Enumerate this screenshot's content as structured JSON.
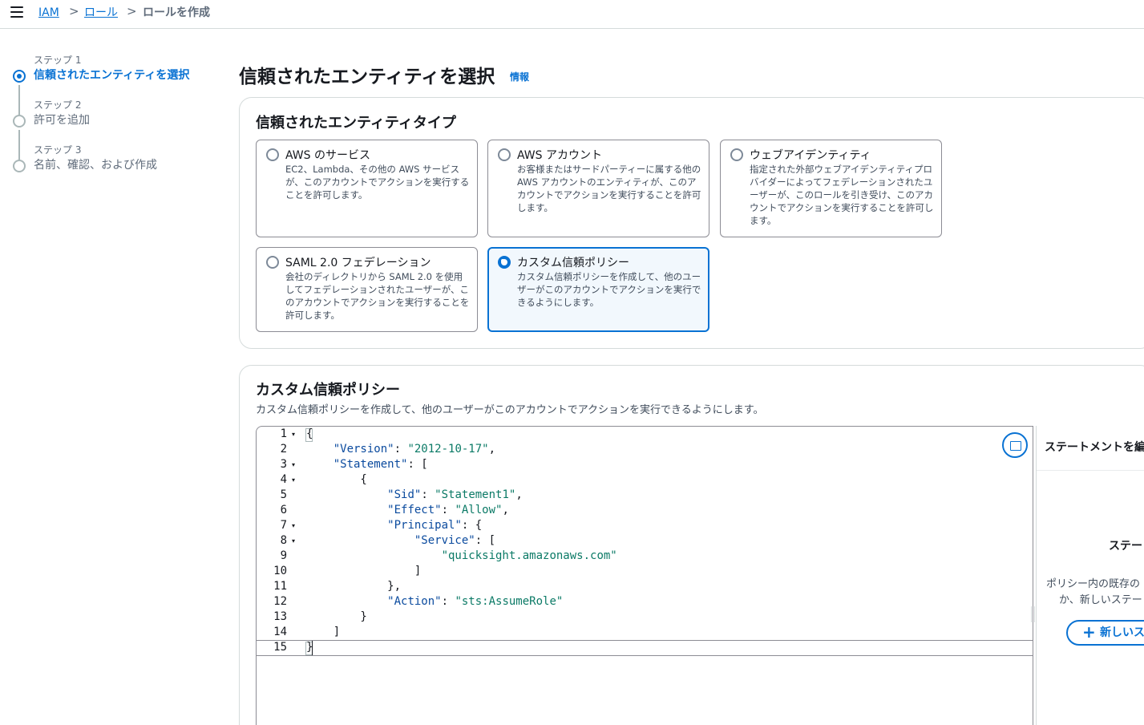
{
  "breadcrumb": {
    "items": [
      "IAM",
      "ロール"
    ],
    "separators": [
      ">",
      ">"
    ],
    "current": "ロールを作成"
  },
  "steps": [
    {
      "label": "ステップ 1",
      "title": "信頼されたエンティティを選択",
      "active": true
    },
    {
      "label": "ステップ 2",
      "title": "許可を追加",
      "active": false
    },
    {
      "label": "ステップ 3",
      "title": "名前、確認、および作成",
      "active": false
    }
  ],
  "page": {
    "title": "信頼されたエンティティを選択",
    "info_link": "情報"
  },
  "entity_type": {
    "title": "信頼されたエンティティタイプ",
    "options": [
      {
        "title": "AWS のサービス",
        "desc": "EC2、Lambda、その他の AWS サービスが、このアカウントでアクションを実行することを許可します。",
        "selected": false
      },
      {
        "title": "AWS アカウント",
        "desc": "お客様またはサードパーティーに属する他の AWS アカウントのエンティティが、このアカウントでアクションを実行することを許可します。",
        "selected": false
      },
      {
        "title": "ウェブアイデンティティ",
        "desc": "指定された外部ウェブアイデンティティプロバイダーによってフェデレーションされたユーザーが、このロールを引き受け、このアカウントでアクションを実行することを許可します。",
        "selected": false
      },
      {
        "title": "SAML 2.0 フェデレーション",
        "desc": "会社のディレクトリから SAML 2.0 を使用してフェデレーションされたユーザーが、このアカウントでアクションを実行することを許可します。",
        "selected": false
      },
      {
        "title": "カスタム信頼ポリシー",
        "desc": "カスタム信頼ポリシーを作成して、他のユーザーがこのアカウントでアクションを実行できるようにします。",
        "selected": true
      }
    ]
  },
  "custom_policy": {
    "title": "カスタム信頼ポリシー",
    "desc": "カスタム信頼ポリシーを作成して、他のユーザーがこのアカウントでアクションを実行できるようにします。",
    "line_numbers": [
      "1",
      "2",
      "3",
      "4",
      "5",
      "6",
      "7",
      "8",
      "9",
      "10",
      "11",
      "12",
      "13",
      "14",
      "15"
    ],
    "fold_marker": "▾",
    "code": {
      "version_key": "\"Version\"",
      "version_val": "\"2012-10-17\"",
      "statement_key": "\"Statement\"",
      "sid_key": "\"Sid\"",
      "sid_val": "\"Statement1\"",
      "effect_key": "\"Effect\"",
      "effect_val": "\"Allow\"",
      "principal_key": "\"Principal\"",
      "service_key": "\"Service\"",
      "service_val": "\"quicksight.amazonaws.com\"",
      "action_key": "\"Action\"",
      "action_val": "\"sts:AssumeRole\""
    }
  },
  "statement_panel": {
    "title": "ステートメントを編",
    "heading": "ステー",
    "text_line1": "ポリシー内の既存の",
    "text_line2": "か、新しいステー",
    "add_button": "新しいス",
    "plus": "+"
  },
  "colors": {
    "accent": "#0972d3",
    "string": "#0b7a66",
    "key": "#0a4a9e"
  }
}
